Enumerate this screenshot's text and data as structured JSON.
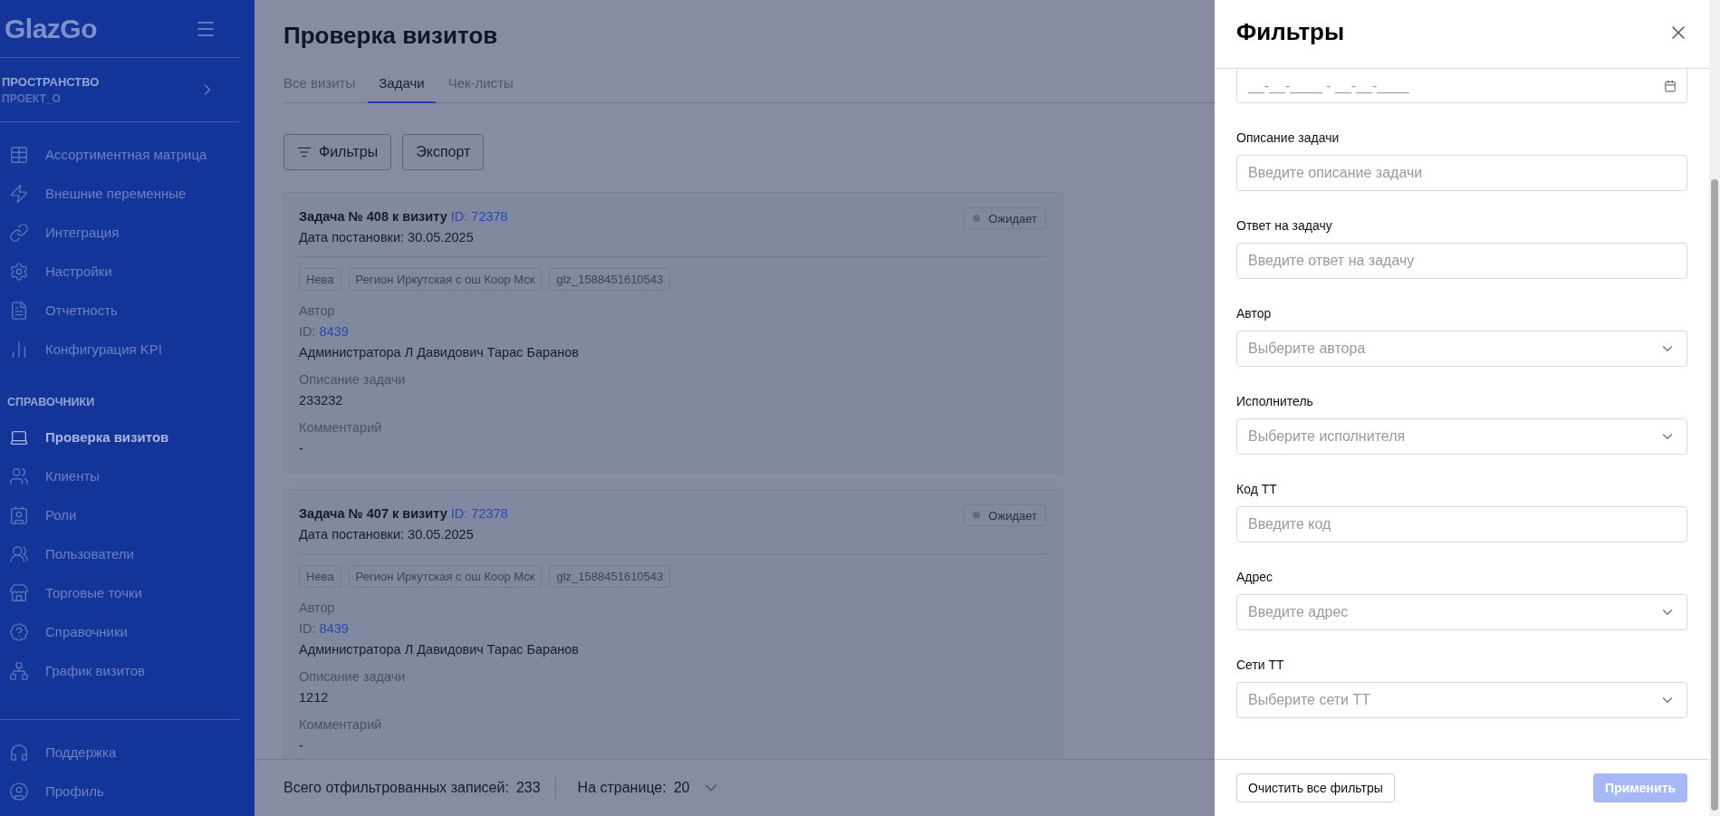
{
  "sidebar": {
    "logo": "GlazGo",
    "workspace": {
      "label": "ПРОСТРАНСТВО",
      "value": "ПРОЕКТ_О"
    },
    "groups": [
      {
        "items": [
          {
            "label": "Ассортиментная матрица",
            "selected": false
          },
          {
            "label": "Внешние переменные",
            "selected": false
          },
          {
            "label": "Интеграция",
            "selected": false
          },
          {
            "label": "Настройки",
            "selected": false
          },
          {
            "label": "Отчетность",
            "selected": false
          },
          {
            "label": "Конфигурация KPI",
            "selected": false
          }
        ]
      },
      {
        "title": "СПРАВОЧНИКИ",
        "items": [
          {
            "label": "Проверка визитов",
            "selected": true
          },
          {
            "label": "Клиенты",
            "selected": false
          },
          {
            "label": "Роли",
            "selected": false
          },
          {
            "label": "Пользователи",
            "selected": false
          },
          {
            "label": "Торговые точки",
            "selected": false
          },
          {
            "label": "Справочники",
            "selected": false
          },
          {
            "label": "График визитов",
            "selected": false
          }
        ]
      }
    ],
    "bottom_items": [
      {
        "label": "Поддержка",
        "selected": false
      },
      {
        "label": "Профиль",
        "selected": false
      }
    ]
  },
  "main": {
    "title": "Проверка визитов",
    "tabs": [
      {
        "label": "Все визиты",
        "selected": false
      },
      {
        "label": "Задачи",
        "selected": true
      },
      {
        "label": "Чек-листы",
        "selected": false
      }
    ],
    "toolbar": [
      {
        "label": "Фильтры",
        "kind": "filter"
      },
      {
        "label": "Экспорт",
        "kind": "plain"
      }
    ],
    "cards": [
      {
        "title": "Задача № 408 к визиту",
        "visit_id": "ID: 72378",
        "date": "Дата постановки: 30.05.2025",
        "status": "Ожидает",
        "tags": [
          "Нева",
          "Регион Иркутская с ош Коор Мск",
          "glz_1588451610543"
        ],
        "author_label": "Автор",
        "author_id_prefix": "ID:",
        "author_id": "8439",
        "author_name": "Администратора Л Давидович Тарас Баранов",
        "description_label": "Описание задачи",
        "description": "233232",
        "comment_label": "Комментарий",
        "comment": "-"
      },
      {
        "title": "Задача № 407 к визиту",
        "visit_id": "ID: 72378",
        "date": "Дата постановки: 30.05.2025",
        "status": "Ожидает",
        "tags": [
          "Нева",
          "Регион Иркутская с ош Коор Мск",
          "glz_1588451610543"
        ],
        "author_label": "Автор",
        "author_id_prefix": "ID:",
        "author_id": "8439",
        "author_name": "Администратора Л Давидович Тарас Баранов",
        "description_label": "Описание задачи",
        "description": "1212",
        "comment_label": "Комментарий",
        "comment": "-"
      }
    ],
    "footer": {
      "total_label": "Всего отфильтрованных записей:",
      "total": "233",
      "per_page_label": "На странице:",
      "per_page": "20"
    }
  },
  "filters": {
    "title": "Фильтры",
    "date_range": {
      "placeholder": "__-__-____ - __-__-____"
    },
    "fields": [
      {
        "label": "Описание задачи",
        "placeholder": "Введите описание задачи",
        "kind": "text"
      },
      {
        "label": "Ответ на задачу",
        "placeholder": "Введите ответ на задачу",
        "kind": "text"
      },
      {
        "label": "Автор",
        "placeholder": "Выберите автора",
        "kind": "select"
      },
      {
        "label": "Исполнитель",
        "placeholder": "Выберите исполнителя",
        "kind": "select"
      },
      {
        "label": "Код ТТ",
        "placeholder": "Введите код",
        "kind": "text"
      },
      {
        "label": "Адрес",
        "placeholder": "Введите адрес",
        "kind": "select"
      },
      {
        "label": "Сети ТТ",
        "placeholder": "Выберите сети ТТ",
        "kind": "select"
      }
    ],
    "clear_button": "Очистить все фильтры",
    "apply_button": {
      "label": "Применить",
      "disabled": true
    }
  }
}
